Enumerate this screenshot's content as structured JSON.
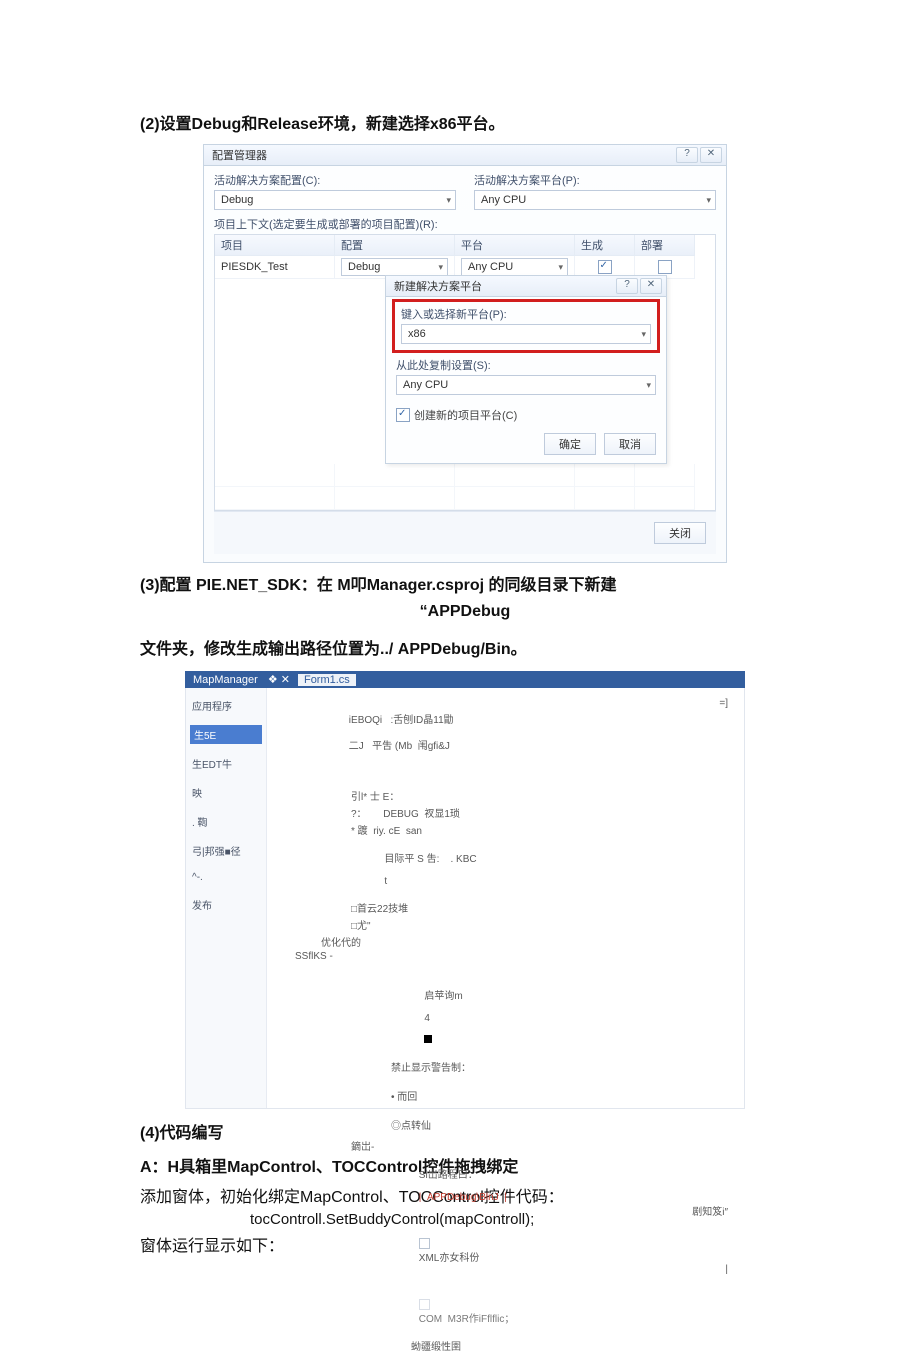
{
  "step2": {
    "heading": "(2)设置Debug和Release环境，新建选择x86平台。"
  },
  "dialog1": {
    "title": "配置管理器",
    "label_active_config": "活动解决方案配置(C):",
    "label_active_platform": "活动解决方案平台(P):",
    "active_config_value": "Debug",
    "active_platform_value": "Any CPU",
    "subnote": "项目上下文(选定要生成或部署的项目配置)(R):",
    "col_project": "项目",
    "col_config": "配置",
    "col_platform": "平台",
    "col_build": "生成",
    "col_deploy": "部署",
    "row_project": "PIESDK_Test",
    "row_config": "Debug",
    "row_platform": "Any CPU",
    "popup_title": "新建解决方案平台",
    "popup_label_new": "键入或选择新平台(P):",
    "popup_value_new": "x86",
    "popup_label_copy": "从此处复制设置(S):",
    "popup_value_copy": "Any CPU",
    "popup_chk": "创建新的项目平台(C)",
    "btn_ok": "确定",
    "btn_cancel": "取消",
    "btn_close": "关闭"
  },
  "step3": {
    "line1_prefix": "(3)配置  PIE.NET_SDK：在  M叩Manager.csproj 的同级目录下新建",
    "line2": "“APPDebug",
    "line3": "文件夹，修改生成输出路径位置为../ APPDebug/Bin。"
  },
  "prop": {
    "tab1": "MapManager",
    "tab1_state": "❖ ✕",
    "tab2": "Form1.cs",
    "sidebar": [
      "应用程序",
      "生5E",
      "生EDT牛",
      "映",
      ". 鞫",
      "弓|邦强■径",
      "^-.",
      "发布"
    ],
    "sidebar_sel_index": 1,
    "top_left_1": "iEBOQi   :舌刨ID晶11勖",
    "top_right_1": "二J   平吿 (Mb  闱gfi&J",
    "top_right_end": "=]",
    "l_intro": "引l* 士 E：",
    "l_debug": "?：      DEBUG  衩显1琐",
    "l_r": "* 踱  riy. cE  san",
    "l_target": "目际平 S 吿:    . KBC",
    "l_target_r": "t",
    "l_opt1": "□首云22技堆",
    "l_opt2": "□尤\"",
    "l_opt3": "优化代的",
    "l_ss": "SSflKS -",
    "l_warn": "启苹询m",
    "l_warn_r": "4",
    "l_suppress": "禁止显示警告制：",
    "l_radio1": "• 而回",
    "l_radio2": "◎点转仙",
    "l_out_head": "鏑岀-",
    "l_out_path_lbl": "Si岀路程曰：",
    "l_out_path_val": "|  APPDebug\\BlnJ  |",
    "l_out_path_r": "剧知笈i″",
    "l_xml": "XML亦女科份",
    "l_xml_r": "|",
    "l_com": "COM  M3R作iFflflic；",
    "l_meta": "蚴疆缎性圉"
  },
  "step4": {
    "heading": "(4)代码编写",
    "lineA": "A：H具箱里MapControl、TOCControl控件拖拽绑定",
    "p1": "添加窗体，初始化绑定MapControl、TOCControl控件代码：",
    "code": "tocControll.SetBuddyControl(mapControll);",
    "p2": "窗体运行显示如下："
  }
}
